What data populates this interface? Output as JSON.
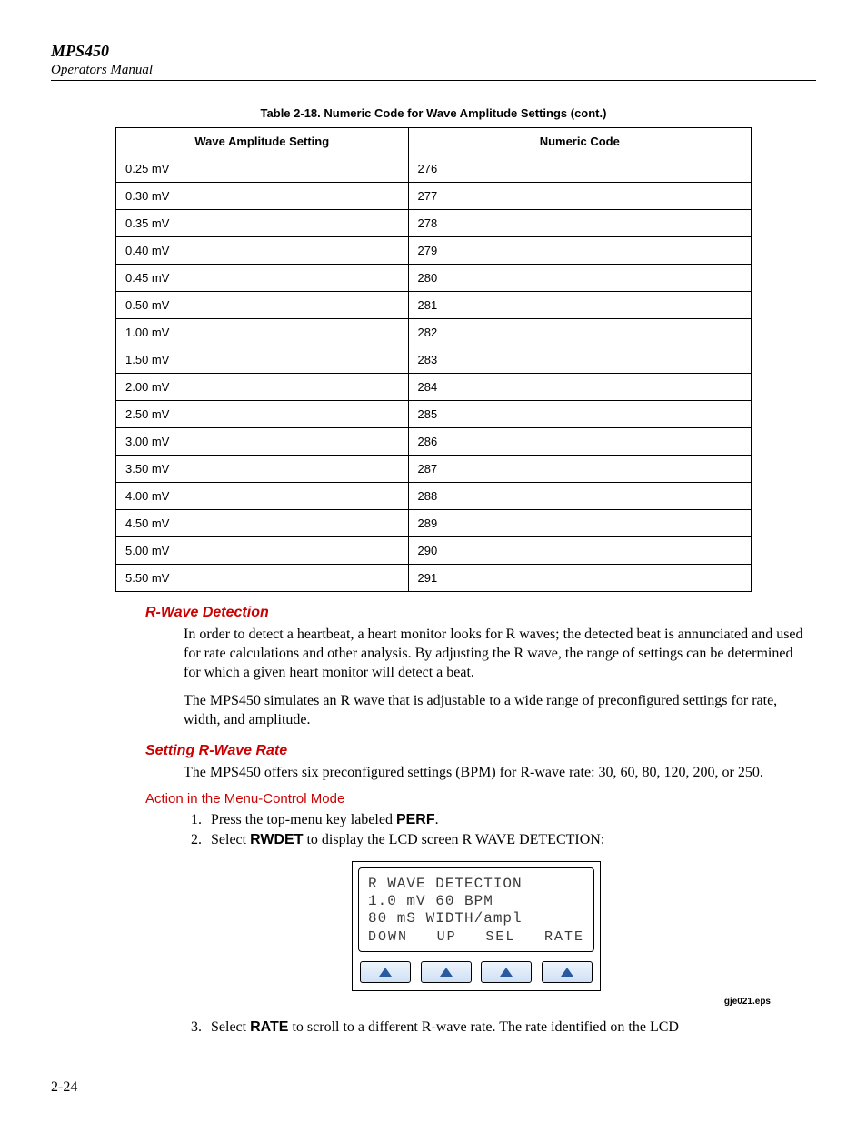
{
  "header": {
    "model": "MPS450",
    "subtitle": "Operators Manual"
  },
  "table": {
    "caption": "Table 2-18. Numeric Code for Wave Amplitude Settings (cont.)",
    "col1": "Wave Amplitude Setting",
    "col2": "Numeric Code",
    "rows": [
      {
        "setting": "0.25 mV",
        "code": "276"
      },
      {
        "setting": "0.30 mV",
        "code": "277"
      },
      {
        "setting": "0.35 mV",
        "code": "278"
      },
      {
        "setting": "0.40 mV",
        "code": "279"
      },
      {
        "setting": "0.45 mV",
        "code": "280"
      },
      {
        "setting": "0.50 mV",
        "code": "281"
      },
      {
        "setting": "1.00 mV",
        "code": "282"
      },
      {
        "setting": "1.50 mV",
        "code": "283"
      },
      {
        "setting": "2.00 mV",
        "code": "284"
      },
      {
        "setting": "2.50 mV",
        "code": "285"
      },
      {
        "setting": "3.00 mV",
        "code": "286"
      },
      {
        "setting": "3.50 mV",
        "code": "287"
      },
      {
        "setting": "4.00 mV",
        "code": "288"
      },
      {
        "setting": "4.50 mV",
        "code": "289"
      },
      {
        "setting": "5.00 mV",
        "code": "290"
      },
      {
        "setting": "5.50 mV",
        "code": "291"
      }
    ]
  },
  "sections": {
    "rwave_h": "R-Wave Detection",
    "rwave_p1": "In order to detect a heartbeat, a heart monitor looks for R waves; the detected beat is annunciated and used for rate calculations and other analysis. By adjusting the R wave, the range of settings can be determined for which a given heart monitor will detect a beat.",
    "rwave_p2": "The MPS450 simulates an R wave that is adjustable to a wide range of preconfigured settings for rate, width, and amplitude.",
    "setrate_h": "Setting R-Wave Rate",
    "setrate_p": "The MPS450 offers six preconfigured settings (BPM) for R-wave rate: 30, 60, 80, 120, 200, or 250.",
    "action_h": "Action in the Menu-Control Mode",
    "step1_a": "Press the top-menu key labeled ",
    "step1_b": "PERF",
    "step1_c": ".",
    "step2_a": "Select ",
    "step2_b": "RWDET",
    "step2_c": " to display the LCD screen R WAVE DETECTION:",
    "step3_a": "Select ",
    "step3_b": "RATE",
    "step3_c": " to scroll to a different R-wave rate. The rate identified on the LCD"
  },
  "lcd": {
    "l1": "R WAVE DETECTION",
    "l2": "1.0 mV 60 BPM",
    "l3": " 80 mS WIDTH/ampl",
    "k1": "DOWN",
    "k2": "UP",
    "k3": "SEL",
    "k4": "RATE"
  },
  "eps": "gje021.eps",
  "page": "2-24"
}
